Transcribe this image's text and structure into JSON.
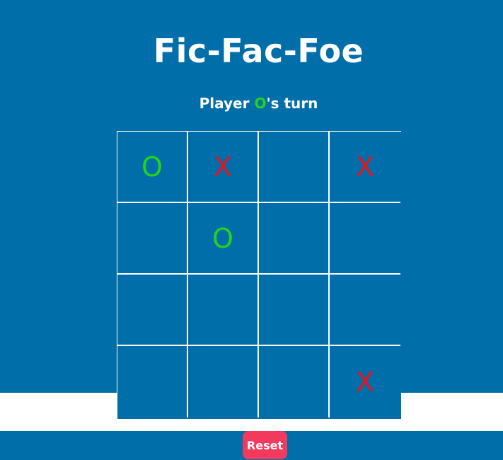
{
  "title": "Fic-Fac-Foe",
  "status": {
    "prefix": "Player ",
    "player": "O",
    "suffix": "'s turn"
  },
  "board": {
    "cells": [
      "O",
      "X",
      "",
      "X",
      "",
      "O",
      "",
      "",
      "",
      "",
      "",
      "",
      "",
      "",
      "",
      "X"
    ]
  },
  "reset_label": "Reset",
  "colors": {
    "background": "#006ea8",
    "x_mark": "#e8141f",
    "o_mark": "#22d41c",
    "reset_button": "#f23a5f",
    "text": "#ffffff"
  }
}
